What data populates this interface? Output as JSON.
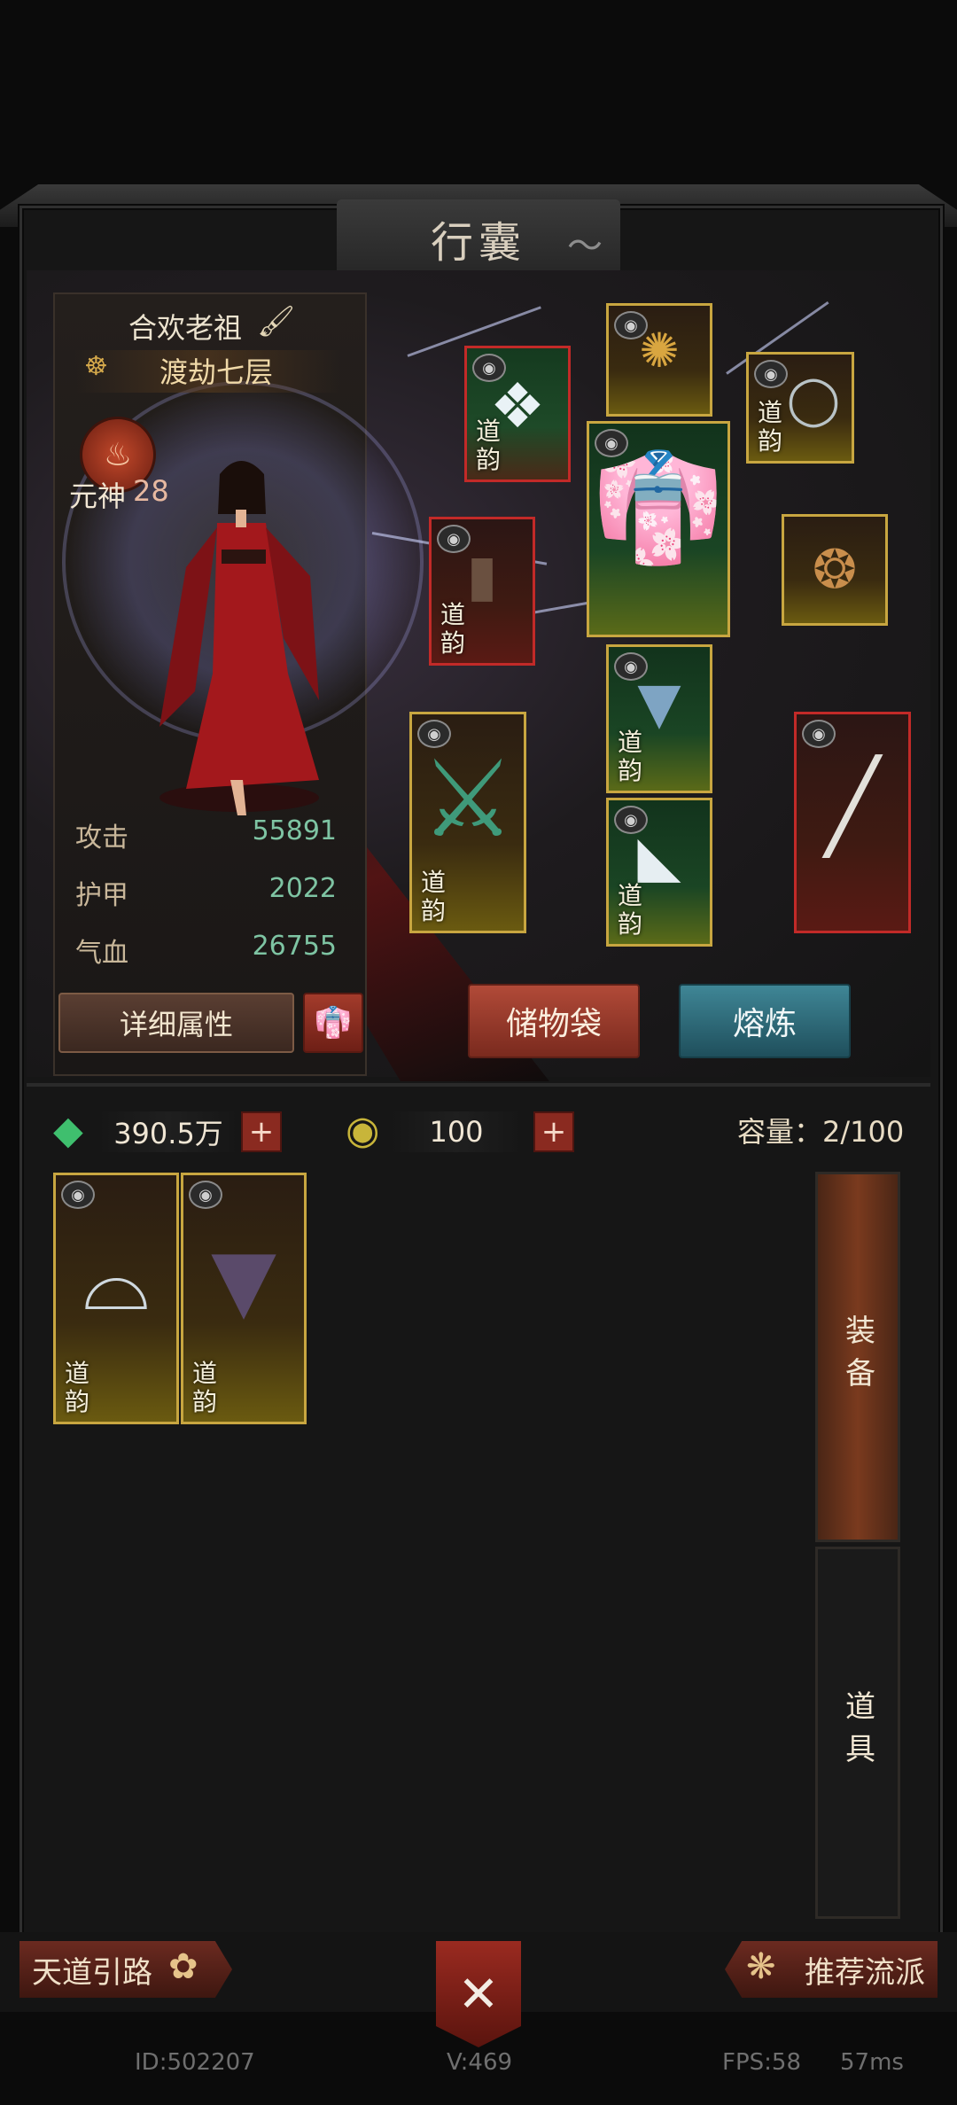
{
  "window": {
    "title": "行囊"
  },
  "character": {
    "name": "合欢老祖",
    "realm": "渡劫七层",
    "soul_label": "元神",
    "soul_level": "28",
    "stats": [
      {
        "label": "攻击",
        "value": "55891"
      },
      {
        "label": "护甲",
        "value": "2022"
      },
      {
        "label": "气血",
        "value": "26755"
      }
    ]
  },
  "buttons": {
    "detail": "详细属性",
    "bag": "储物袋",
    "smelt": "熔炼"
  },
  "equipment": {
    "slot_tag": "道\n韵",
    "slot_tag_top": "道",
    "slot_tag_bottom": "韵"
  },
  "currency": {
    "spirit_stone": "390.5万",
    "jade": "100",
    "capacity": "容量：2/100"
  },
  "tabs": {
    "equip": "装备",
    "items": "道具"
  },
  "bottom": {
    "guide": "天道引路",
    "recommend": "推荐流派"
  },
  "footer": {
    "id": "ID:502207",
    "version": "V:469",
    "fps": "FPS:58",
    "latency": "57ms"
  },
  "icons": {
    "brush": "brush-icon",
    "realm": "buddha-icon",
    "lock": "lock-icon",
    "gem": "spirit-stone-icon",
    "jade": "jade-icon",
    "guide": "guide-icon",
    "recommend": "recommend-icon",
    "center": "crossed-swords-icon",
    "outfit": "outfit-icon"
  },
  "colors": {
    "gold_border": "#c8a640",
    "red_border": "#c22a28",
    "stat_value": "#7ec4a3",
    "smelt": "#3f8696",
    "bag": "#b14a38"
  }
}
